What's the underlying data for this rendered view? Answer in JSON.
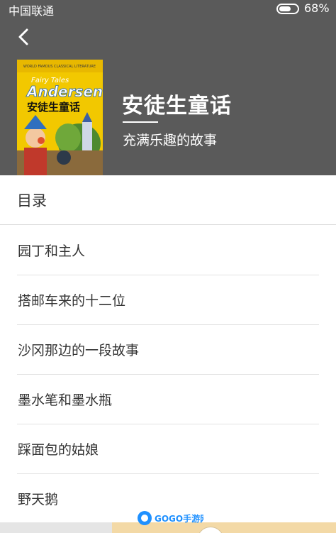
{
  "status_bar": {
    "carrier": "中国联通",
    "battery_percent": "68%",
    "battery_level": 0.68
  },
  "nav": {
    "back_icon": "chevron-left-icon"
  },
  "book": {
    "cover": {
      "series_text": "WORLD FAMOUS CLASSICAL LITERATURE",
      "title_en_line1": "Fairy Tales",
      "title_en_line2": "Andersen",
      "title_cn": "安徒生童话",
      "background_color": "#f2c800"
    },
    "title": "安徒生童话",
    "subtitle": "充满乐趣的故事"
  },
  "toc": {
    "heading": "目录",
    "chapters": [
      "园丁和主人",
      "搭邮车来的十二位",
      "沙冈那边的一段故事",
      "墨水笔和墨水瓶",
      "踩面包的姑娘",
      "野天鹅"
    ]
  },
  "watermark": {
    "text": "GOGO手游网"
  },
  "colors": {
    "header_bg": "#5a5a5a",
    "divider": "#e2e2e2",
    "text": "#333333"
  }
}
